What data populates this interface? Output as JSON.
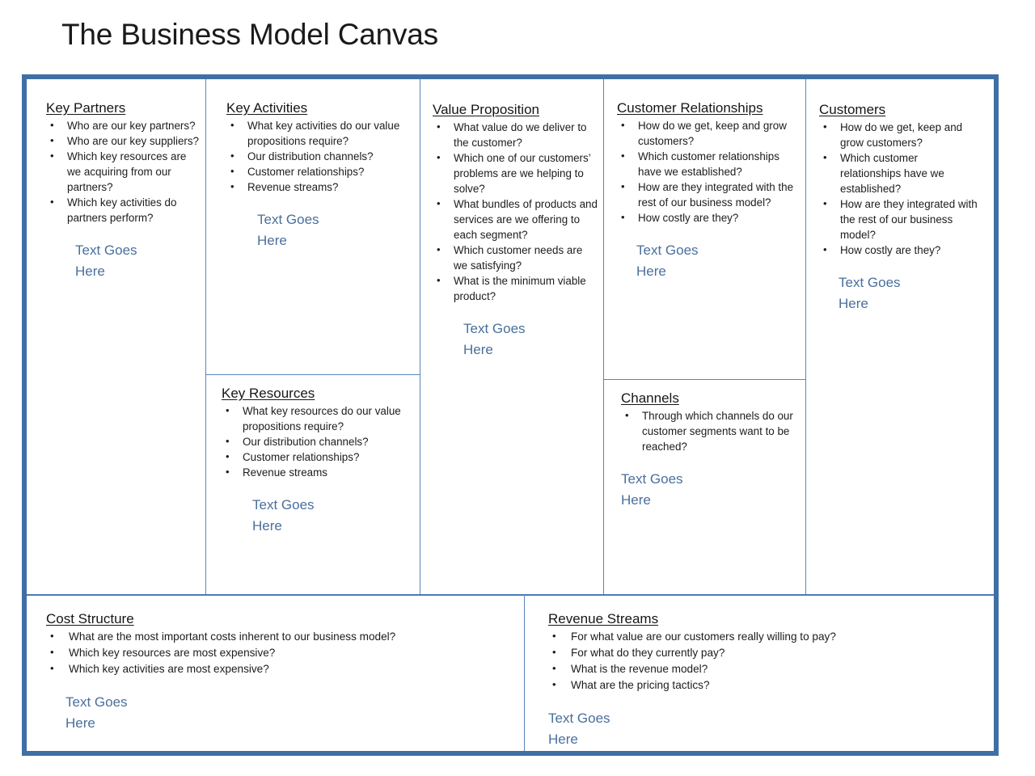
{
  "title": "The Business Model Canvas",
  "colors": {
    "frame_blue": "#3f6fa5",
    "divider_blue": "#5a86b8",
    "placeholder_blue": "#4a6f9c",
    "text_black": "#1c1c1c"
  },
  "placeholder": {
    "line1": "Text Goes",
    "line2": "Here"
  },
  "blocks": {
    "key_partners": {
      "title": "Key Partners",
      "bullets": [
        "Who are our key partners?",
        "Who are our key suppliers?",
        "Which key resources are we acquiring from our partners?",
        "Which key activities do partners perform?"
      ]
    },
    "key_activities": {
      "title": "Key Activities",
      "bullets": [
        "What key activities do our value propositions require?",
        "Our distribution channels?",
        "Customer relationships?",
        "Revenue streams?"
      ]
    },
    "key_resources": {
      "title": "Key Resources",
      "bullets": [
        "What key resources do our value propositions require?",
        "Our distribution channels?",
        "Customer relationships?",
        "Revenue streams"
      ]
    },
    "value_proposition": {
      "title": "Value Proposition",
      "bullets": [
        "What value do we deliver to the customer?",
        "Which one of our customers’ problems are we helping to solve?",
        "What bundles of products and services are we offering to each segment?",
        "Which customer needs are we satisfying?",
        "What is the minimum viable product?"
      ]
    },
    "customer_relationships": {
      "title": "Customer Relationships",
      "bullets": [
        "How do we get, keep and grow customers?",
        "Which customer relationships have we established?",
        "How are they integrated with the rest of our business model?",
        "How costly are they?"
      ]
    },
    "channels": {
      "title": "Channels",
      "bullets": [
        "Through which channels do our customer segments want to be reached?"
      ]
    },
    "customers": {
      "title": "Customers",
      "bullets": [
        "How do we get, keep and grow customers?",
        "Which customer relationships have we established?",
        "How are they integrated with the rest of our business model?",
        "How costly are they?"
      ]
    },
    "cost_structure": {
      "title": "Cost Structure",
      "bullets": [
        "What are the most important costs inherent to our business model?",
        "Which key resources are most expensive?",
        "Which key activities are most expensive?"
      ]
    },
    "revenue_streams": {
      "title": "Revenue Streams",
      "bullets": [
        "For what value are our customers really willing to pay?",
        "For what do they currently pay?",
        "What is the revenue model?",
        "What are the pricing tactics?"
      ]
    }
  }
}
